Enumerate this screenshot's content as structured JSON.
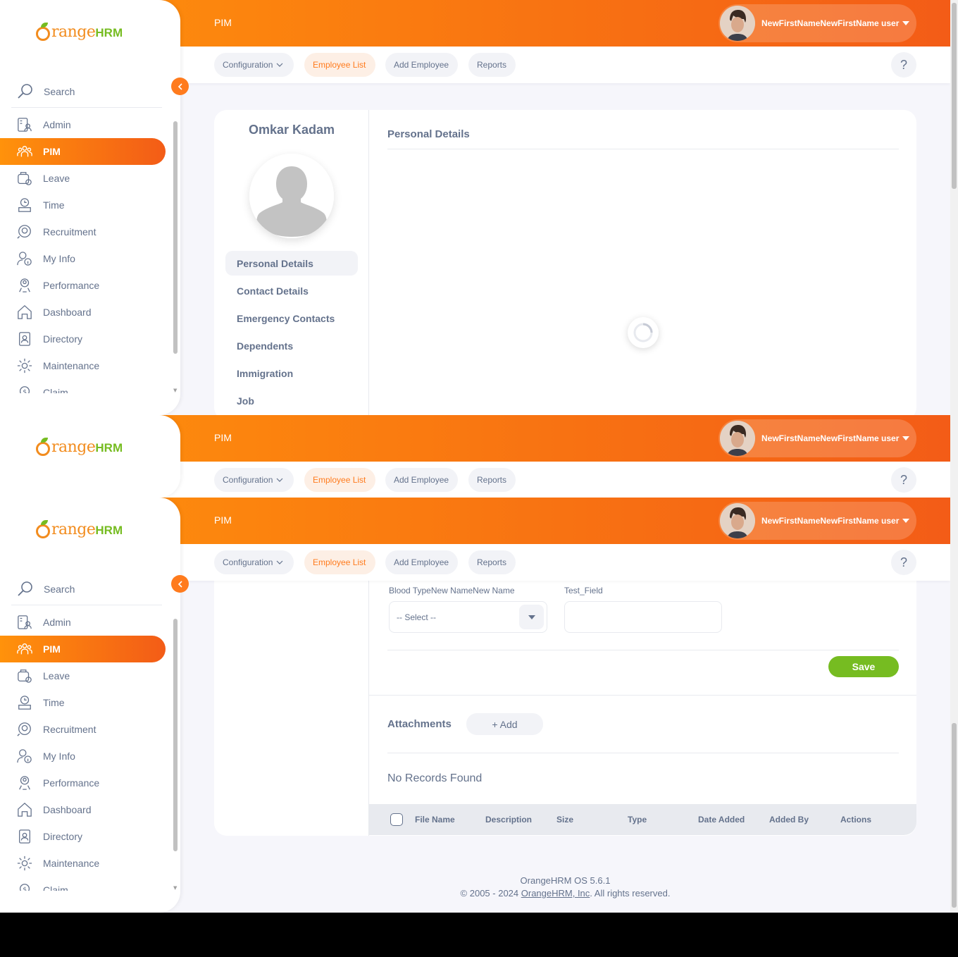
{
  "app": {
    "brand_main": "range",
    "brand_suffix": "HRM",
    "module_title": "PIM"
  },
  "user": {
    "name": "NewFirstNameNewFirstName user"
  },
  "sidebar": {
    "search_label": "Search",
    "items": [
      {
        "label": "Admin",
        "icon": "admin-icon"
      },
      {
        "label": "PIM",
        "icon": "pim-icon",
        "active": true
      },
      {
        "label": "Leave",
        "icon": "leave-icon"
      },
      {
        "label": "Time",
        "icon": "time-icon"
      },
      {
        "label": "Recruitment",
        "icon": "recruitment-icon"
      },
      {
        "label": "My Info",
        "icon": "my-info-icon"
      },
      {
        "label": "Performance",
        "icon": "performance-icon"
      },
      {
        "label": "Dashboard",
        "icon": "dashboard-icon"
      },
      {
        "label": "Directory",
        "icon": "directory-icon"
      },
      {
        "label": "Maintenance",
        "icon": "maintenance-icon"
      },
      {
        "label": "Claim",
        "icon": "claim-icon"
      }
    ]
  },
  "topnav": {
    "configuration": "Configuration",
    "employee_list": "Employee List",
    "add_employee": "Add Employee",
    "reports": "Reports",
    "help": "?"
  },
  "employee": {
    "name": "Omkar Kadam",
    "tabs": [
      "Personal Details",
      "Contact Details",
      "Emergency Contacts",
      "Dependents",
      "Immigration",
      "Job"
    ]
  },
  "personal_details": {
    "title": "Personal Details"
  },
  "custom_fields": {
    "blood_type_label": "Blood TypeNew NameNew Name",
    "blood_type_value": "-- Select --",
    "test_field_label": "Test_Field",
    "save": "Save"
  },
  "attachments": {
    "title": "Attachments",
    "add": "+ Add",
    "no_records": "No Records Found",
    "columns": [
      "File Name",
      "Description",
      "Size",
      "Type",
      "Date Added",
      "Added By",
      "Actions"
    ]
  },
  "footer": {
    "version": "OrangeHRM OS 5.6.1",
    "copyright_pre": "© 2005 - 2024 ",
    "company_link": "OrangeHRM, Inc",
    "copyright_post": ". All rights reserved."
  },
  "colors": {
    "accent": "#ff7b1d",
    "gradient_start": "#ff920b",
    "gradient_end": "#f35c17",
    "save_green": "#76bc21",
    "text": "#64728c"
  }
}
